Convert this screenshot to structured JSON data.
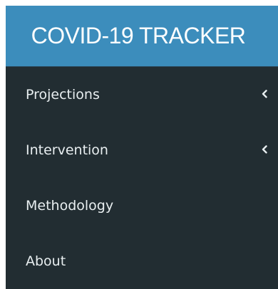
{
  "header": {
    "title": "COVID-19 TRACKER"
  },
  "sidebar": {
    "items": [
      {
        "label": "Projections",
        "icon": "chevron-left-icon",
        "expandable": true
      },
      {
        "label": "Intervention",
        "icon": "chevron-left-icon",
        "expandable": true
      },
      {
        "label": "Methodology",
        "expandable": false
      },
      {
        "label": "About",
        "expandable": false
      }
    ]
  },
  "colors": {
    "header_bg": "#3c8dbc",
    "sidebar_bg": "#222d32",
    "text": "#e8eef0"
  }
}
